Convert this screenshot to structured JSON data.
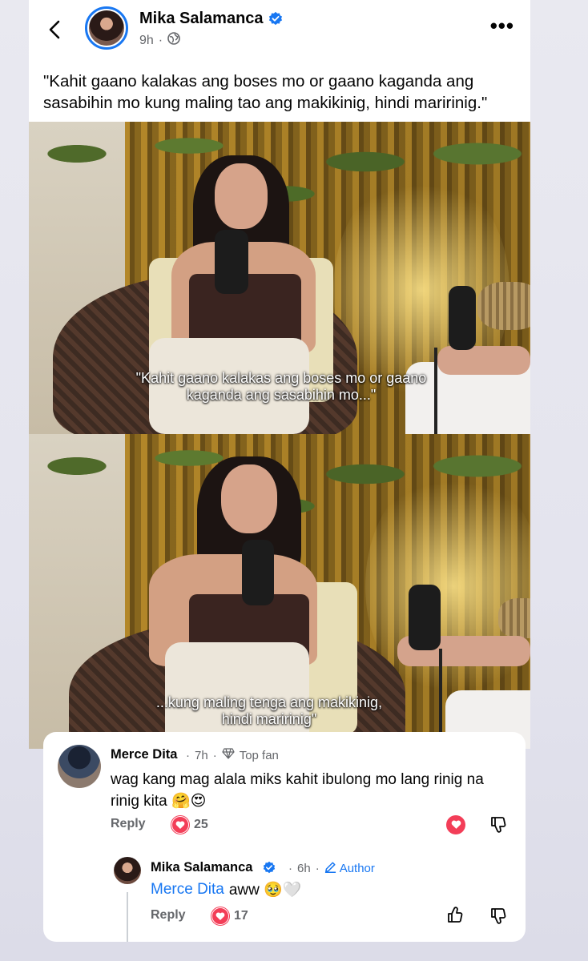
{
  "post": {
    "author": "Mika Salamanca",
    "time": "9h",
    "dot": "·",
    "more_icon": "•••",
    "caption": "\"Kahit gaano kalakas ang boses mo or gaano kaganda ang sasabihin mo kung maling tao ang makikinig, hindi maririnig.\"",
    "photos": [
      {
        "subtitle": "\"Kahit gaano kalakas ang boses mo or gaano kaganda ang sasabihin mo...\""
      },
      {
        "subtitle": "...kung maling tenga ang makikinig, hindi maririnig\""
      }
    ]
  },
  "comment": {
    "name": "Merce Dita",
    "time": "7h",
    "dot": "·",
    "badge": "Top fan",
    "text": "wag kang mag alala miks kahit ibulong mo lang rinig na rinig kita 🤗😍",
    "reply_label": "Reply",
    "reaction_count": "25"
  },
  "reply": {
    "name": "Mika Salamanca",
    "time": "6h",
    "dot": "·",
    "author_label": "Author",
    "mention": "Merce Dita",
    "text": "aww 🥹🤍",
    "reply_label": "Reply",
    "reaction_count": "17"
  },
  "colors": {
    "accent": "#1877f2",
    "heart": "#f33e58",
    "muted": "#65676b"
  }
}
